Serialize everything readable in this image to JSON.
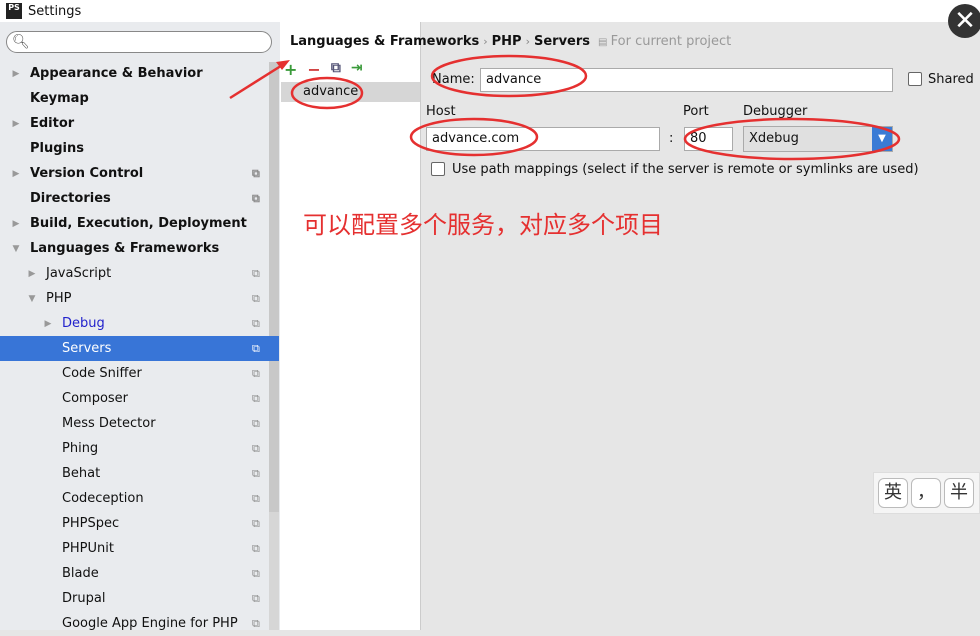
{
  "window": {
    "title": "Settings",
    "app_icon_text": "PS"
  },
  "sidebar": {
    "search_placeholder": "",
    "items": [
      {
        "label": "Appearance & Behavior",
        "level": 0,
        "bold": true,
        "arrow": "right",
        "copy": false
      },
      {
        "label": "Keymap",
        "level": 0,
        "bold": true,
        "arrow": "",
        "copy": false
      },
      {
        "label": "Editor",
        "level": 0,
        "bold": true,
        "arrow": "right",
        "copy": false
      },
      {
        "label": "Plugins",
        "level": 0,
        "bold": true,
        "arrow": "",
        "copy": false
      },
      {
        "label": "Version Control",
        "level": 0,
        "bold": true,
        "arrow": "right",
        "copy": true
      },
      {
        "label": "Directories",
        "level": 0,
        "bold": true,
        "arrow": "",
        "copy": true
      },
      {
        "label": "Build, Execution, Deployment",
        "level": 0,
        "bold": true,
        "arrow": "right",
        "copy": false
      },
      {
        "label": "Languages & Frameworks",
        "level": 0,
        "bold": true,
        "arrow": "down",
        "copy": false
      },
      {
        "label": "JavaScript",
        "level": 1,
        "bold": false,
        "arrow": "right",
        "copy": true
      },
      {
        "label": "PHP",
        "level": 1,
        "bold": false,
        "arrow": "down",
        "copy": true
      },
      {
        "label": "Debug",
        "level": 2,
        "bold": false,
        "arrow": "right",
        "copy": true,
        "link": true
      },
      {
        "label": "Servers",
        "level": 2,
        "bold": false,
        "arrow": "",
        "copy": true,
        "selected": true
      },
      {
        "label": "Code Sniffer",
        "level": 2,
        "bold": false,
        "arrow": "",
        "copy": true
      },
      {
        "label": "Composer",
        "level": 2,
        "bold": false,
        "arrow": "",
        "copy": true
      },
      {
        "label": "Mess Detector",
        "level": 2,
        "bold": false,
        "arrow": "",
        "copy": true
      },
      {
        "label": "Phing",
        "level": 2,
        "bold": false,
        "arrow": "",
        "copy": true
      },
      {
        "label": "Behat",
        "level": 2,
        "bold": false,
        "arrow": "",
        "copy": true
      },
      {
        "label": "Codeception",
        "level": 2,
        "bold": false,
        "arrow": "",
        "copy": true
      },
      {
        "label": "PHPSpec",
        "level": 2,
        "bold": false,
        "arrow": "",
        "copy": true
      },
      {
        "label": "PHPUnit",
        "level": 2,
        "bold": false,
        "arrow": "",
        "copy": true
      },
      {
        "label": "Blade",
        "level": 2,
        "bold": false,
        "arrow": "",
        "copy": true
      },
      {
        "label": "Drupal",
        "level": 2,
        "bold": false,
        "arrow": "",
        "copy": true
      },
      {
        "label": "Google App Engine for PHP",
        "level": 2,
        "bold": false,
        "arrow": "",
        "copy": true
      }
    ]
  },
  "breadcrumb": {
    "parts": [
      "Languages & Frameworks",
      "PHP",
      "Servers"
    ],
    "scope": "For current project"
  },
  "servers": {
    "list": [
      "advance"
    ]
  },
  "form": {
    "name_label": "Name:",
    "name_value": "advance",
    "shared_label": "Shared",
    "shared_checked": false,
    "host_label": "Host",
    "host_value": "advance.com",
    "colon": ":",
    "port_label": "Port",
    "port_value": "80",
    "debugger_label": "Debugger",
    "debugger_value": "Xdebug",
    "path_mappings_label": "Use path mappings (select if the server is remote or symlinks are used)",
    "path_mappings_checked": false
  },
  "annotation": {
    "text": "可以配置多个服务，对应多个项目",
    "color": "#e53030"
  },
  "ime": {
    "keys": [
      "英",
      "，",
      "半"
    ]
  },
  "colors": {
    "selection": "#3875d7",
    "add": "#3a9a3a",
    "remove": "#d04040"
  }
}
